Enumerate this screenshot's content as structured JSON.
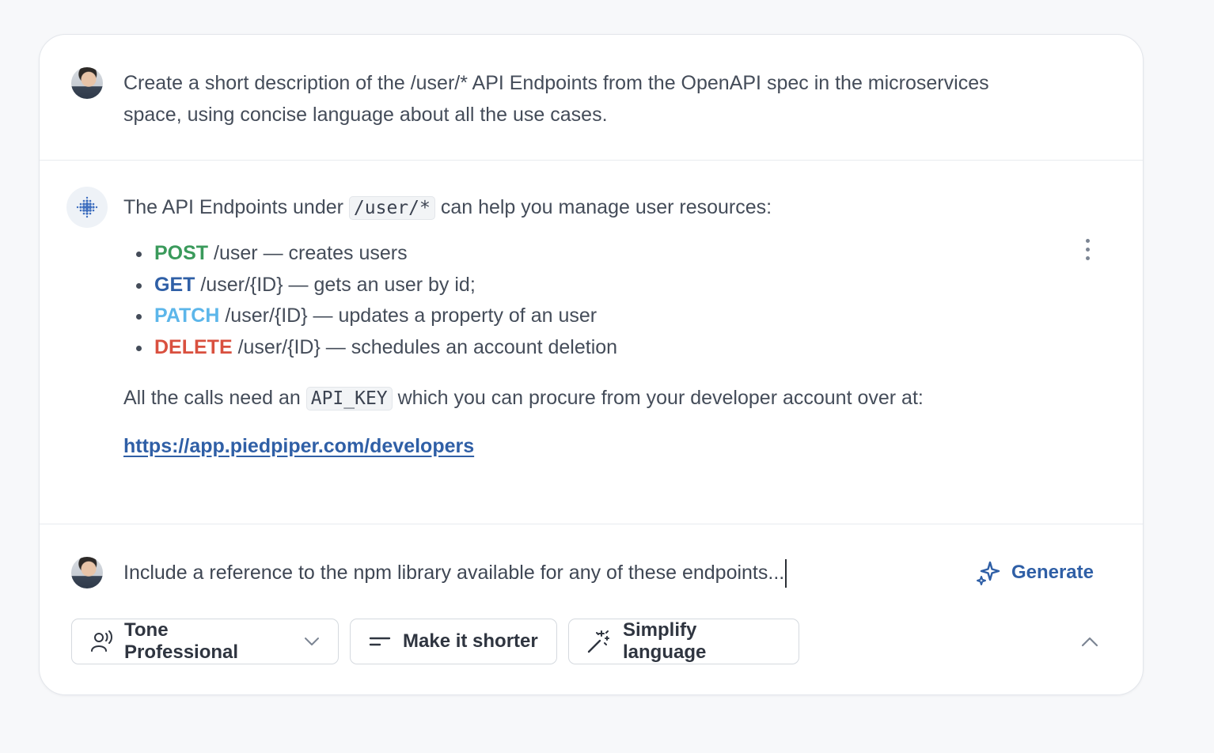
{
  "conversation": {
    "user_prompt": "Create a short description of the /user/* API Endpoints from the OpenAPI spec in the microservices space, using concise language about all the use cases.",
    "assistant": {
      "intro_before": "The API Endpoints under",
      "intro_code": "/user/*",
      "intro_after": "can help you manage user resources:",
      "endpoints": [
        {
          "method": "POST",
          "method_color": "#3a9a5b",
          "path": "/user",
          "desc": " — creates users"
        },
        {
          "method": "GET",
          "method_color": "#2f5fa6",
          "path": "/user/{ID}",
          "desc": " — gets an user by id;"
        },
        {
          "method": "PATCH",
          "method_color": "#5cb6ea",
          "path": "/user/{ID}",
          "desc": " — updates a property of an user"
        },
        {
          "method": "DELETE",
          "method_color": "#d9503f",
          "path": "/user/{ID}",
          "desc": " — schedules an account deletion"
        }
      ],
      "note_before": "All the calls need an",
      "note_code": "API_KEY",
      "note_after": "which you can procure from your developer account over at:",
      "link": "https://app.piedpiper.com/developers"
    }
  },
  "composer": {
    "input_value": "Include a reference to the npm library available for any of these endpoints...",
    "generate_label": "Generate",
    "chips": {
      "tone_label": "Tone Professional",
      "shorter_label": "Make it shorter",
      "simplify_label": "Simplify language"
    }
  },
  "colors": {
    "accent": "#2f5fa6",
    "post": "#3a9a5b",
    "get": "#2f5fa6",
    "patch": "#5cb6ea",
    "delete": "#d9503f"
  },
  "icons": [
    "user-avatar-icon",
    "assistant-dots-icon",
    "kebab-menu-icon",
    "sparkle-icon",
    "voice-user-icon",
    "chevron-down-icon",
    "lines-icon",
    "magic-wand-icon",
    "chevron-up-icon"
  ]
}
